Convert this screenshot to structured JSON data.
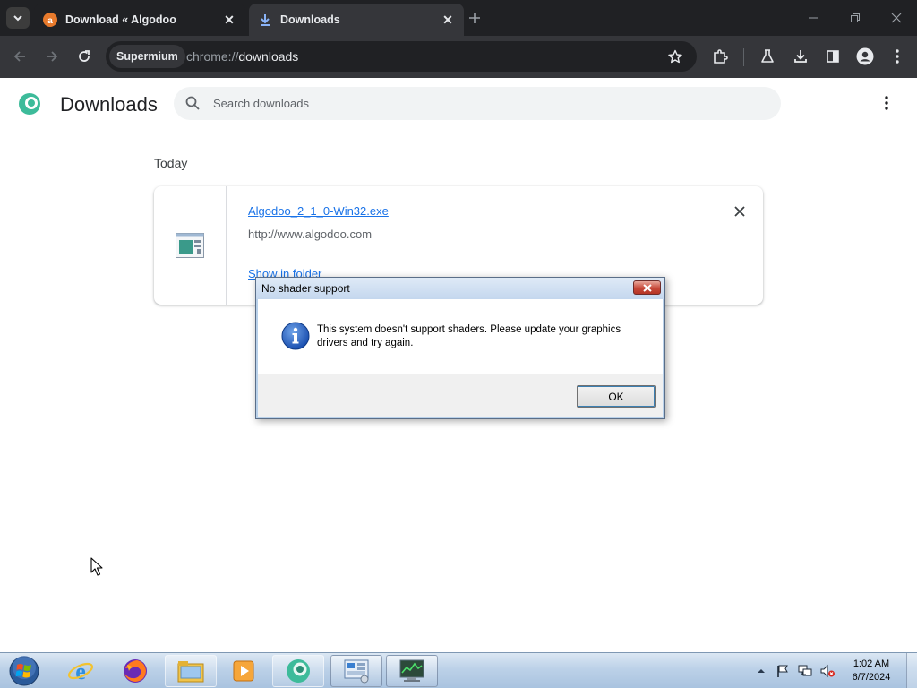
{
  "browser": {
    "tabs": [
      {
        "title": "Download « Algodoo",
        "active": false,
        "favicon": "algodoo-favicon"
      },
      {
        "title": "Downloads",
        "active": true,
        "favicon": "download-favicon"
      }
    ],
    "omnibox": {
      "badge": "Supermium",
      "scheme": "chrome://",
      "host": "downloads"
    }
  },
  "downloads_page": {
    "title": "Downloads",
    "search_placeholder": "Search downloads",
    "section_label": "Today",
    "items": [
      {
        "file_name": "Algodoo_2_1_0-Win32.exe",
        "source_url": "http://www.algodoo.com",
        "action_label": "Show in folder"
      }
    ]
  },
  "dialog": {
    "title": "No shader support",
    "message": "This system doesn't support shaders. Please update your graphics drivers and try again.",
    "ok_label": "OK",
    "icon": "information-icon"
  },
  "taskbar": {
    "clock_time": "1:02 AM",
    "clock_date": "6/7/2024",
    "pinned": [
      "internet-explorer",
      "firefox",
      "file-explorer",
      "media-player",
      "algodoo",
      "control-panel",
      "task-manager"
    ]
  },
  "colors": {
    "tab_strip": "#202124",
    "toolbar": "#35363a",
    "link": "#1a73e8",
    "taskbar": "#bcd1e8"
  }
}
